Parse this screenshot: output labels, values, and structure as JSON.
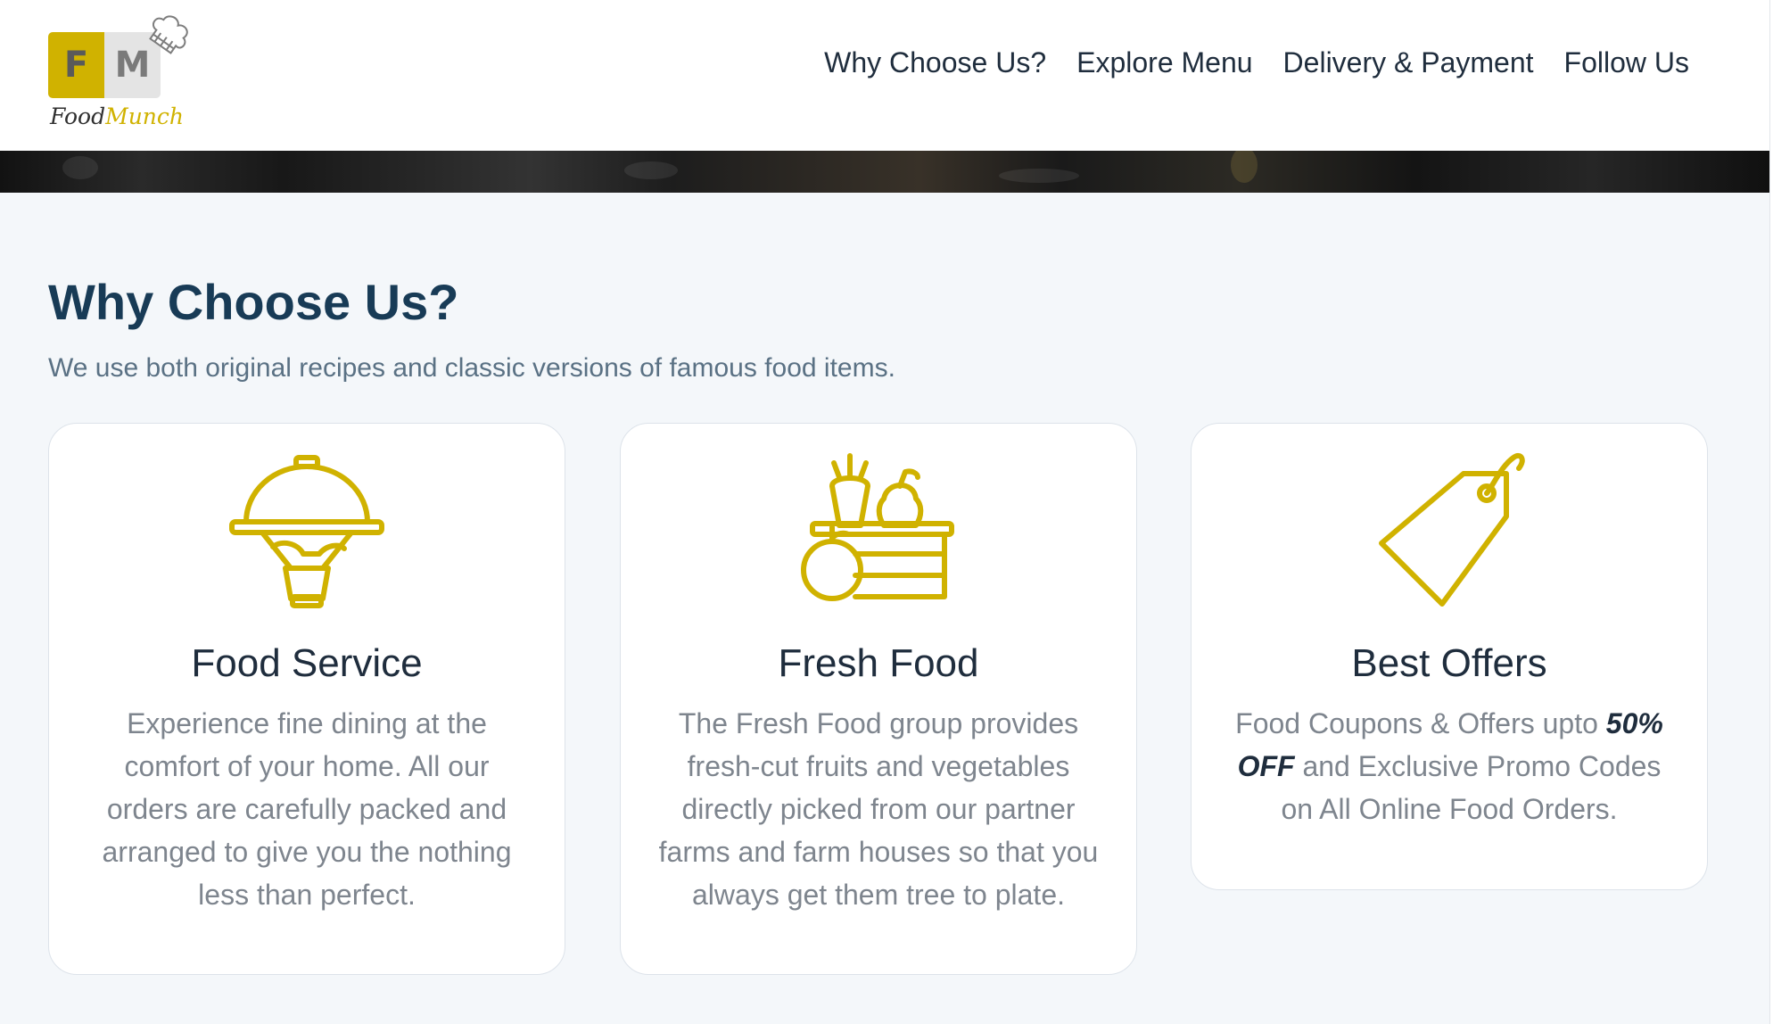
{
  "brand": {
    "logo_letter_1": "F",
    "logo_letter_2": "M",
    "name_part_1": "Food",
    "name_part_2": "Munch",
    "accent_color": "#d0b200"
  },
  "nav": {
    "items": [
      {
        "label": "Why Choose Us?"
      },
      {
        "label": "Explore Menu"
      },
      {
        "label": "Delivery & Payment"
      },
      {
        "label": "Follow Us"
      }
    ]
  },
  "section": {
    "title": "Why Choose Us?",
    "subtitle": "We use both original recipes and classic versions of famous food items.",
    "title_color": "#183b56",
    "subtitle_color": "#5a7184"
  },
  "cards": [
    {
      "icon": "cloche-serving-icon",
      "title": "Food Service",
      "text": "Experience fine dining at the comfort of your home. All our orders are carefully packed and arranged to give you the nothing less than perfect."
    },
    {
      "icon": "fruit-basket-icon",
      "title": "Fresh Food",
      "text": "The Fresh Food group provides fresh-cut fruits and vegetables directly picked from our partner farms and farm houses so that you always get them tree to plate."
    },
    {
      "icon": "price-tag-icon",
      "title": "Best Offers",
      "text_before": "Food Coupons & Offers upto ",
      "text_strong": "50% OFF",
      "text_after": " and Exclusive Promo Codes on All Online Food Orders."
    }
  ]
}
